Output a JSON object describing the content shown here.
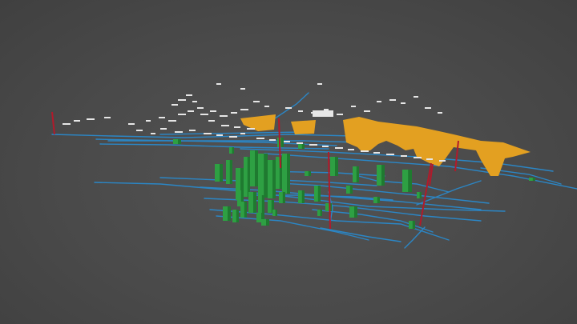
{
  "viewer": {
    "background_color": "#4b4b4b",
    "colors": {
      "terrain_points": "#e6e6e6",
      "structures": "#e3a021",
      "columns": "#2ea043",
      "pipelines": "#2b86c5",
      "markers": "#b11a2b"
    }
  }
}
